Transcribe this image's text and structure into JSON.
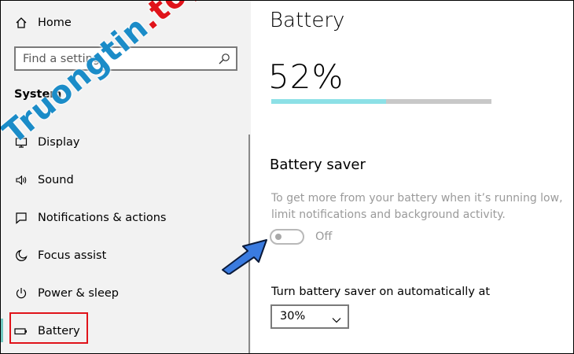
{
  "sidebar": {
    "home_label": "Home",
    "search_placeholder": "Find a setting",
    "section_title": "System",
    "items": [
      {
        "label": "Display",
        "icon": "display-icon"
      },
      {
        "label": "Sound",
        "icon": "speaker-icon"
      },
      {
        "label": "Notifications & actions",
        "icon": "notification-icon"
      },
      {
        "label": "Focus assist",
        "icon": "moon-icon"
      },
      {
        "label": "Power & sleep",
        "icon": "power-icon"
      },
      {
        "label": "Battery",
        "icon": "battery-icon",
        "selected": true
      }
    ]
  },
  "main": {
    "title": "Battery",
    "percent_text": "52%",
    "percent_value": 0.52,
    "saver_heading": "Battery saver",
    "saver_description": "To get more from your battery when it’s running low, limit notifications and background activity.",
    "toggle_label": "Off",
    "toggle_state": false,
    "auto_label": "Turn battery saver on automatically at",
    "auto_value": "30%"
  },
  "watermark": {
    "text_main": "Truongtin",
    "text_dot": ".",
    "text_tld": "top"
  },
  "colors": {
    "accent": "#8ce0e6",
    "selection_bar": "#6fc9c0",
    "highlight_box": "#e0131a",
    "arrow_fill": "#3a7be0"
  }
}
